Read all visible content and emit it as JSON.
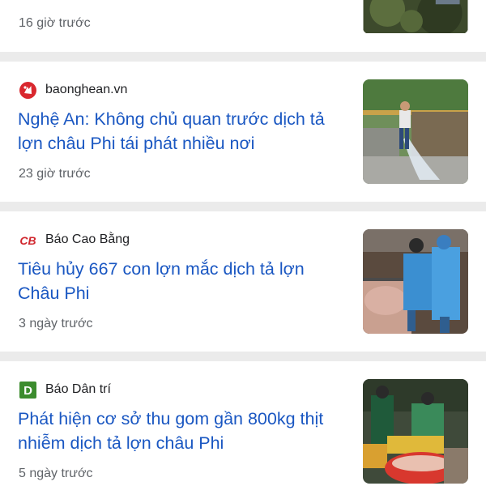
{
  "articles": [
    {
      "time": "16 giờ trước",
      "thumbnail_icon": "cropped-photo-thumbnail"
    },
    {
      "source": "baonghean.vn",
      "logo_icon": "baonghean-logo-icon",
      "title": "Nghệ An: Không chủ quan trước dịch tả lợn châu Phi tái phát nhiều nơi",
      "time": "23 giờ trước",
      "thumbnail_icon": "worker-spraying-pen-photo"
    },
    {
      "source": "Báo Cao Bằng",
      "logo_icon": "cao-bang-logo-icon",
      "logo_text": "CB",
      "title": "Tiêu hủy 667 con lợn mắc dịch tả lợn Châu Phi",
      "time": "3 ngày trước",
      "thumbnail_icon": "workers-culling-pigs-photo"
    },
    {
      "source": "Báo Dân trí",
      "logo_icon": "dan-tri-logo-icon",
      "logo_text": "D",
      "title": "Phát hiện cơ sở thu gom gần 800kg thịt nhiễm dịch tả lợn châu Phi",
      "time": "5 ngày trước",
      "thumbnail_icon": "seized-meat-baskets-photo"
    }
  ],
  "colors": {
    "title": "#1a57c2",
    "meta": "#5f6368",
    "divider": "#ebebeb",
    "baonghean_red": "#d9282f",
    "caobang_red": "#d0262d",
    "dantri_green": "#3c8c2e"
  }
}
